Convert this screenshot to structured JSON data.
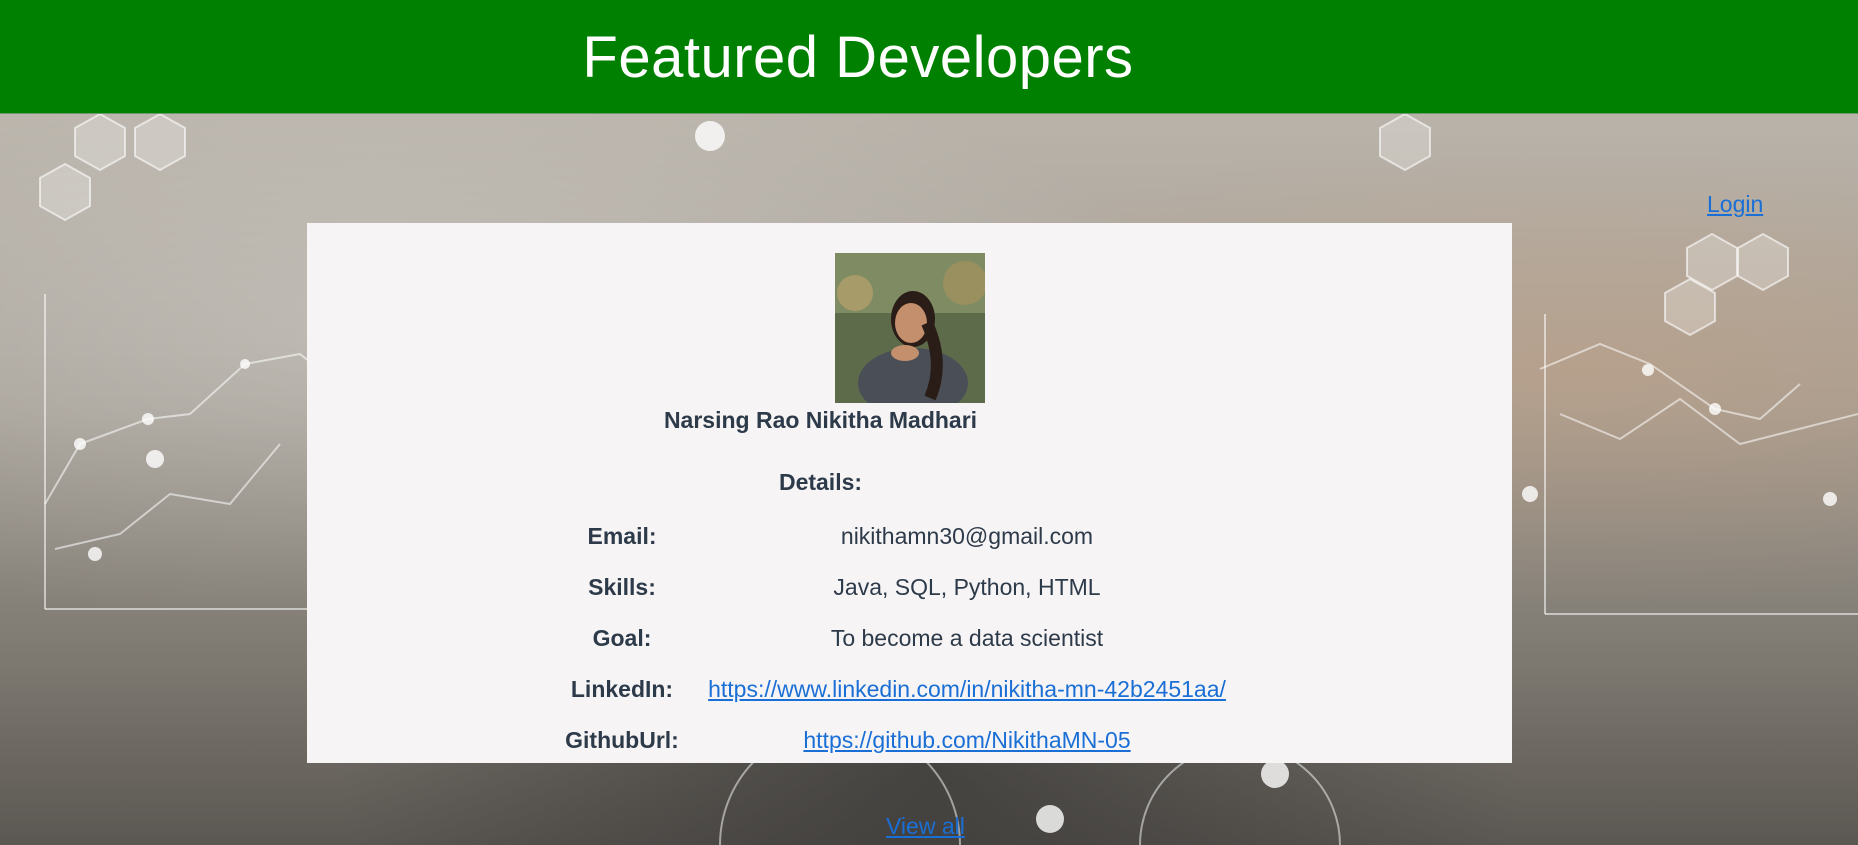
{
  "header": {
    "title": "Featured Developers"
  },
  "nav": {
    "login_label": "Login",
    "view_all_label": "View all"
  },
  "developer": {
    "name": "Narsing Rao Nikitha Madhari",
    "details_heading": "Details:",
    "fields": [
      {
        "label": "Email:",
        "value": "nikithamn30@gmail.com",
        "is_link": false
      },
      {
        "label": "Skills:",
        "value": "Java, SQL, Python, HTML",
        "is_link": false
      },
      {
        "label": "Goal:",
        "value": "To become a data scientist",
        "is_link": false
      },
      {
        "label": "LinkedIn:",
        "value": "https://www.linkedin.com/in/nikitha-mn-42b2451aa/",
        "is_link": true
      },
      {
        "label": "GithubUrl:",
        "value": "https://github.com/NikithaMN-05",
        "is_link": true
      }
    ]
  },
  "colors": {
    "header_bg": "#008000",
    "link": "#1a6fd6",
    "card_bg": "#f6f4f4",
    "text": "#2d3a4a"
  }
}
